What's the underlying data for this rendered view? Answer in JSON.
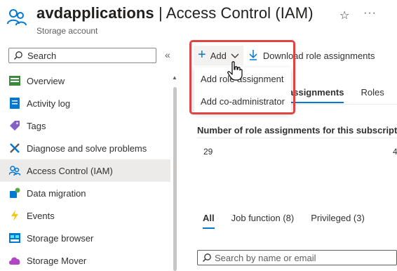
{
  "header": {
    "resource_name": "avdapplications",
    "page_title": " | Access Control (IAM)",
    "subtitle": "Storage account",
    "favorite_icon": "star-outline-icon",
    "more_label": "···"
  },
  "sidebar": {
    "search_placeholder": "Search",
    "collapse_label": "«",
    "items": [
      {
        "label": "Overview",
        "icon": "overview-icon"
      },
      {
        "label": "Activity log",
        "icon": "activity-log-icon"
      },
      {
        "label": "Tags",
        "icon": "tag-icon"
      },
      {
        "label": "Diagnose and solve problems",
        "icon": "wrench-icon"
      },
      {
        "label": "Access Control (IAM)",
        "icon": "people-icon",
        "active": true
      },
      {
        "label": "Data migration",
        "icon": "data-migration-icon"
      },
      {
        "label": "Events",
        "icon": "lightning-icon"
      },
      {
        "label": "Storage browser",
        "icon": "storage-browser-icon"
      },
      {
        "label": "Storage Mover",
        "icon": "cloud-icon"
      }
    ]
  },
  "toolbar": {
    "add_label": "Add",
    "download_label": "Download role assignments"
  },
  "add_menu": {
    "items": [
      "Add role assignment",
      "Add co-administrator"
    ]
  },
  "tabs": {
    "role_assignments": "assignments",
    "roles": "Roles"
  },
  "role_count": {
    "label": "Number of role assignments for this subscriptio",
    "value": "29",
    "value_right": "4"
  },
  "filter_tabs": {
    "all": "All",
    "job_function": "Job function (8)",
    "privileged": "Privileged (3)"
  },
  "search2": {
    "placeholder": "Search by name or email"
  },
  "colors": {
    "accent": "#0078d4",
    "highlight_box": "#e04343",
    "active_nav_bg": "#edebe9"
  }
}
